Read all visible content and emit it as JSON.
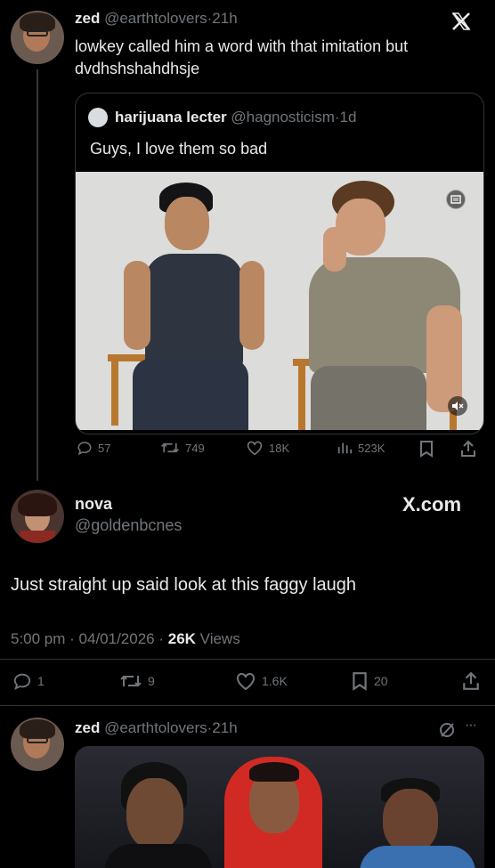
{
  "tweet1": {
    "name": "zed",
    "handle": "@earthtolovers",
    "time": "21h",
    "text_line1": "lowkey called him a word with that imitation but",
    "text_line2": "dvdhshshahdhsje"
  },
  "quote": {
    "name": "harijuana lecter",
    "handle": "@hagnosticism",
    "time": "1d",
    "text": "Guys, I love them so bad",
    "stats": {
      "replies": "57",
      "reposts": "749",
      "likes": "18K",
      "views": "523K"
    }
  },
  "tweet2": {
    "name": "nova",
    "handle": "@goldenbcnes",
    "brand": "X.com",
    "text": "Just straight up said look at this faggy laugh",
    "time": "5:00 pm",
    "date": "04/01/2026",
    "views_count": "26K",
    "views_label": "Views",
    "stats": {
      "replies": "1",
      "reposts": "9",
      "likes": "1.6K",
      "bookmarks": "20"
    }
  },
  "tweet3": {
    "name": "zed",
    "handle": "@earthtolovers",
    "time": "21h",
    "more": "···"
  },
  "colors": {
    "background": "#000000",
    "text": "#e7e9ea",
    "muted": "#71767b"
  }
}
